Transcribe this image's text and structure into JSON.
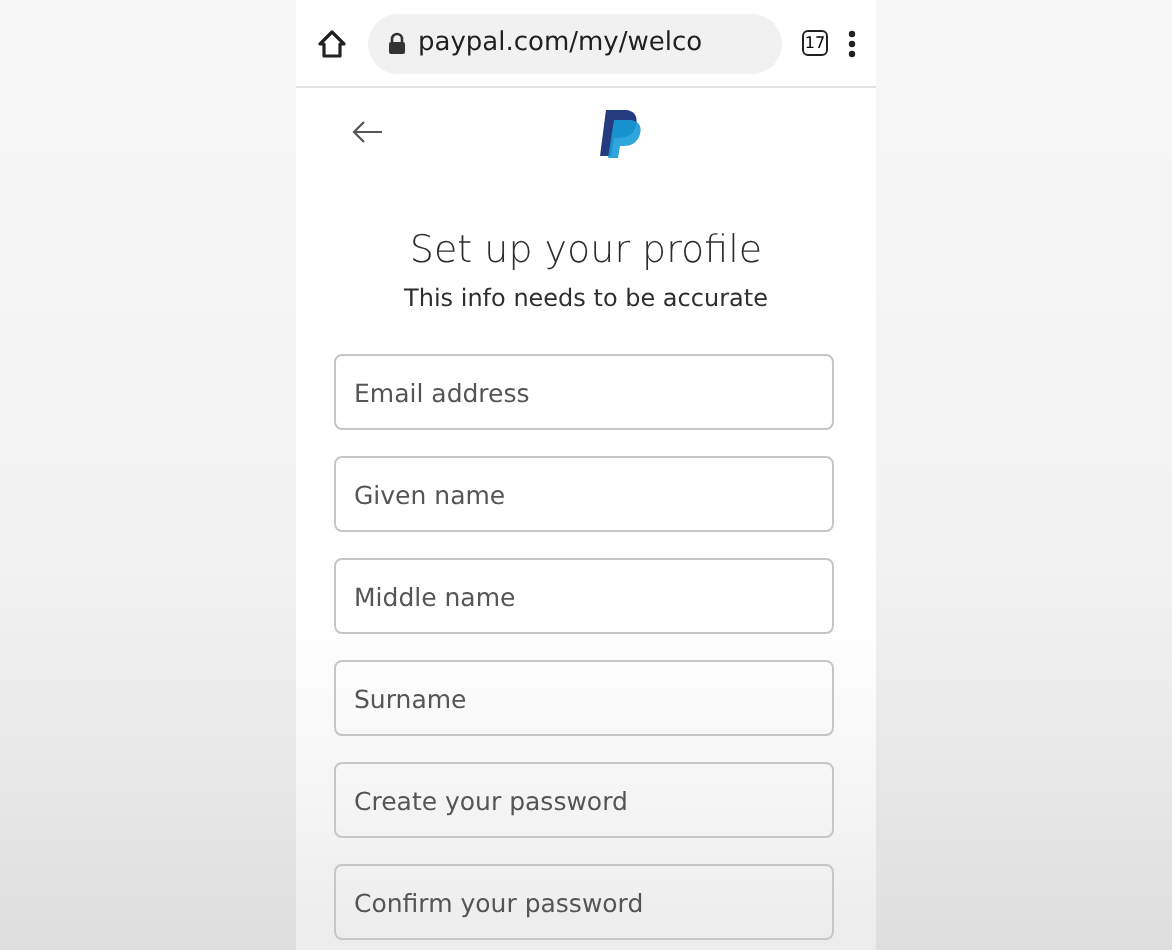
{
  "browser_bar": {
    "url": "paypal.com/my/welco",
    "tab_count": "17"
  },
  "heading": "Set up your profile",
  "subheading": "This info needs to be accurate",
  "fields": [
    {
      "placeholder": "Email address"
    },
    {
      "placeholder": "Given name"
    },
    {
      "placeholder": "Middle name"
    },
    {
      "placeholder": "Surname"
    },
    {
      "placeholder": "Create your password"
    },
    {
      "placeholder": "Confirm your password"
    }
  ]
}
